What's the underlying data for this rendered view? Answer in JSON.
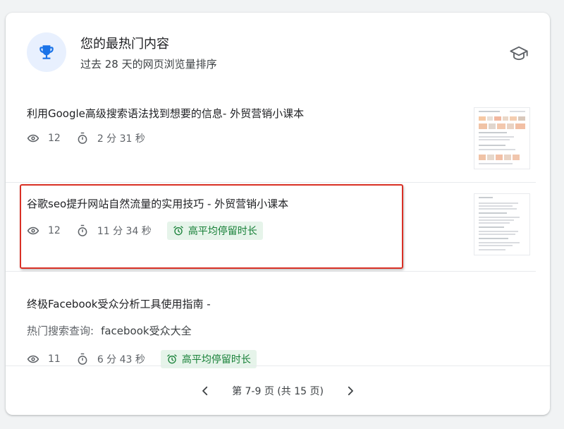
{
  "header": {
    "title": "您的最热门内容",
    "subtitle": "过去 28 天的网页浏览量排序",
    "icon": "trophy-icon",
    "action_icon": "graduation-cap-icon",
    "accent_color": "#1a73e8"
  },
  "items": [
    {
      "title": "利用Google高级搜索语法找到想要的信息- 外贸营销小课本",
      "views": "12",
      "duration": "2 分 31 秒",
      "badge": "",
      "query_label": "",
      "query_value": ""
    },
    {
      "title": "谷歌seo提升网站自然流量的实用技巧 - 外贸营销小课本",
      "views": "12",
      "duration": "11 分 34 秒",
      "badge": "高平均停留时长",
      "query_label": "",
      "query_value": ""
    },
    {
      "title": "终极Facebook受众分析工具使用指南 -",
      "views": "11",
      "duration": "6 分 43 秒",
      "badge": "高平均停留时长",
      "query_label": "热门搜索查询:",
      "query_value": "facebook受众大全"
    }
  ],
  "pager": {
    "text": "第 7-9 页 (共 15 页)",
    "prev_icon": "chevron-left-icon",
    "next_icon": "chevron-right-icon"
  },
  "colors": {
    "badge_bg": "#e6f4ea",
    "badge_text": "#188038",
    "highlight": "#d93025"
  }
}
